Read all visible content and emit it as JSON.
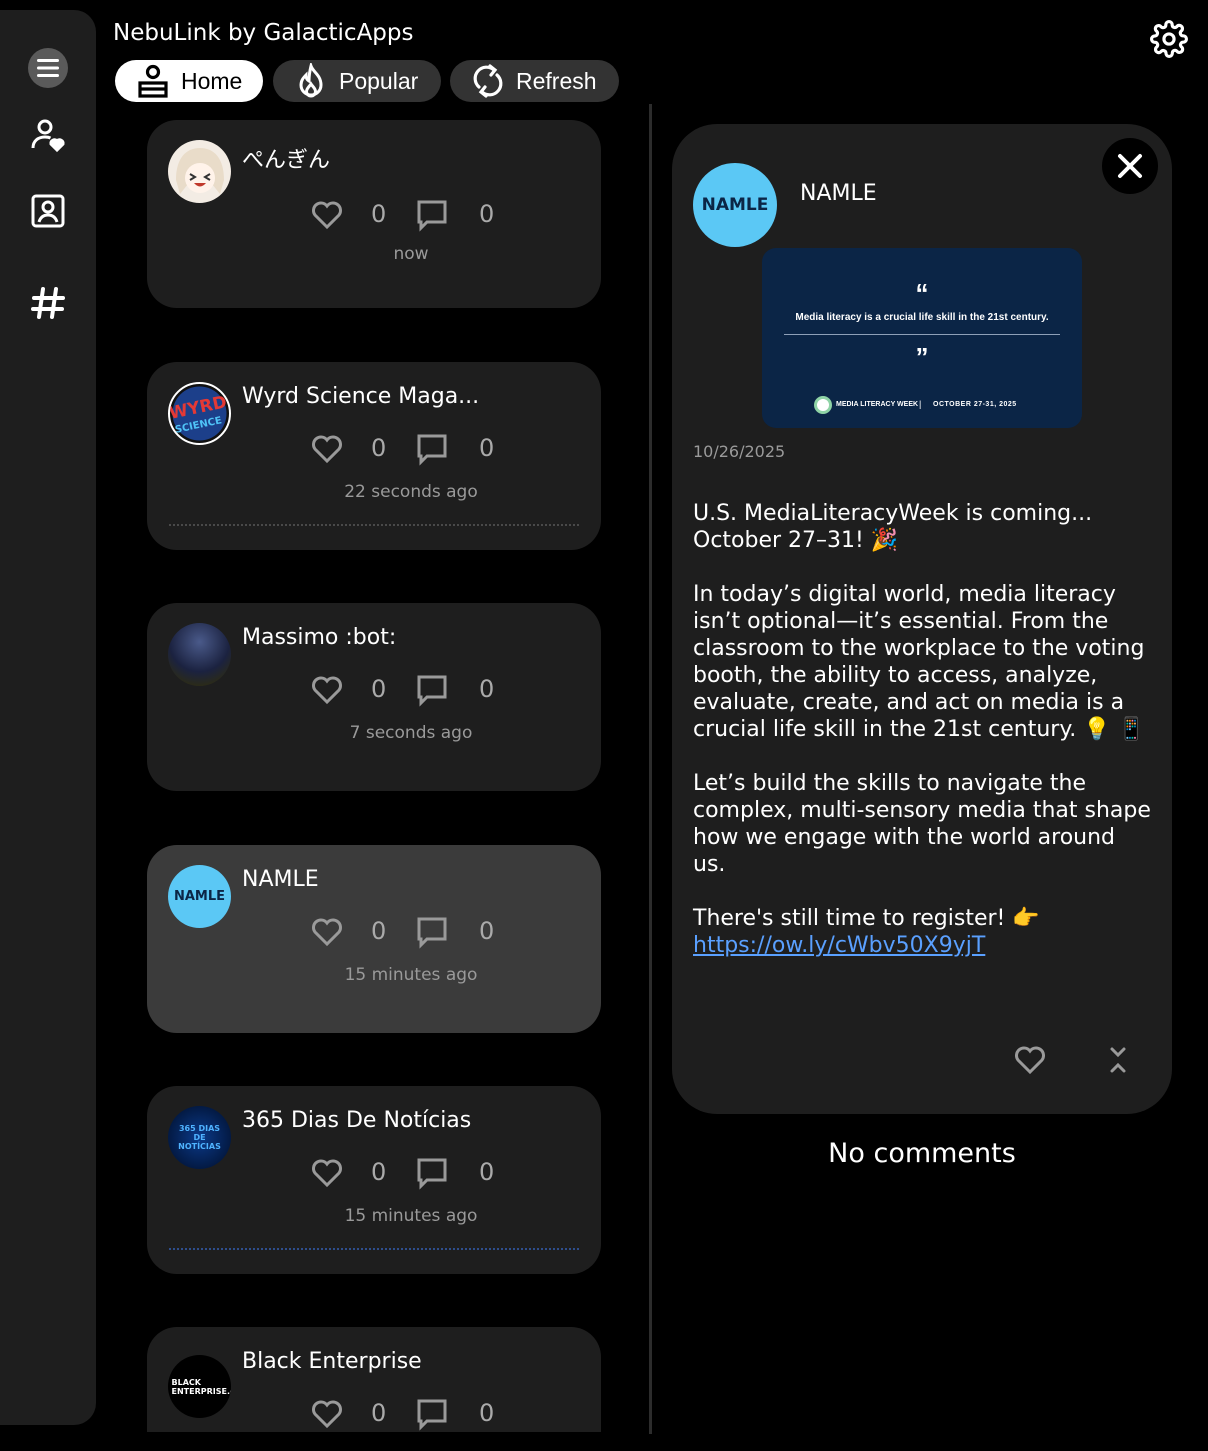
{
  "app": {
    "title": "NebuLink by GalacticApps"
  },
  "sidebar": {
    "items": [
      {
        "icon": "menu-icon"
      },
      {
        "icon": "user-heart-icon"
      },
      {
        "icon": "contact-book-icon"
      },
      {
        "icon": "hashtag-icon"
      }
    ]
  },
  "nav": {
    "home": "Home",
    "popular": "Popular",
    "refresh": "Refresh"
  },
  "colors": {
    "background": "#000000",
    "panel": "#1e1e1e",
    "selected_card": "#3b3b3b",
    "link": "#5aa0ff",
    "namle_blue": "#5bc8f5"
  },
  "feed": {
    "posts": [
      {
        "author": "ぺんぎん",
        "likes": "0",
        "comments": "0",
        "time": "now"
      },
      {
        "author": "Wyrd Science Maga...",
        "likes": "0",
        "comments": "0",
        "time": "22 seconds ago",
        "avatar_text": "WYRD SCIENCE"
      },
      {
        "author": "Massimo :bot:",
        "likes": "0",
        "comments": "0",
        "time": "7 seconds ago"
      },
      {
        "author": "NAMLE",
        "likes": "0",
        "comments": "0",
        "time": "15 minutes ago",
        "avatar_text": "NAMLE"
      },
      {
        "author": "365 Dias De Notícias",
        "likes": "0",
        "comments": "0",
        "time": "15 minutes ago",
        "avatar_text": "365 DIAS DE NOTÍCIAS"
      },
      {
        "author": "Black Enterprise",
        "likes": "0",
        "comments": "0",
        "time": "",
        "avatar_text": "BLACK ENTERPRISE.com"
      }
    ]
  },
  "detail": {
    "author": "NAMLE",
    "avatar_text": "NAMLE",
    "image": {
      "open_quote": "“",
      "quote": "Media literacy is a crucial life skill in the 21st century.",
      "close_quote": "”",
      "small_text": "MEDIA LITERACY WEEK",
      "separator": "|",
      "dates": "OCTOBER 27-31, 2025"
    },
    "date": "10/26/2025",
    "paragraphs": [
      "U.S. MediaLiteracyWeek is coming... October 27–31! 🎉",
      "In today’s digital world, media literacy isn’t optional—it’s essential. From the classroom to the workplace to the voting booth, the ability to access, analyze, evaluate, create, and act on media is a crucial life skill in the 21st century. 💡 📱",
      "Let’s build the skills to navigate the complex, multi-sensory media that shape how we engage with the world around us."
    ],
    "register_text": "There's still time to register! 👉",
    "link": "https://ow.ly/cWbv50X9yjT"
  },
  "comments": {
    "empty_text": "No comments"
  }
}
